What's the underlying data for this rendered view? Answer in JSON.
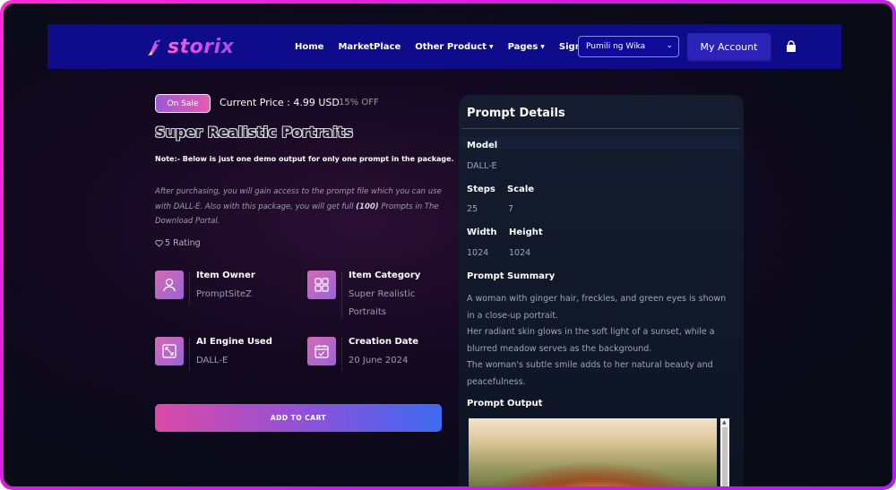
{
  "nav": {
    "logo_text": "storix",
    "links": {
      "home": "Home",
      "marketplace": "MarketPlace",
      "other_product": "Other Product",
      "pages": "Pages",
      "signin": "Sign in"
    },
    "language_select": "Pumili ng Wika",
    "account_button": "My Account"
  },
  "product": {
    "sale_badge": "On Sale",
    "current_price": "Current Price : 4.99 USD",
    "discount": "15% OFF",
    "title": "Super Realistic Portraits",
    "note": "Note:- Below is just one demo output for only one prompt in the package.",
    "desc_part1": "After purchasing, you will gain access to the prompt file which you can use with DALL-E. Also with this package, you will get full ",
    "desc_bold": "(100)",
    "desc_part2": " Prompts in The Download Portal.",
    "rating": "5 Rating",
    "item_owner_label": "Item Owner",
    "item_owner_value": "PromptSiteZ",
    "item_category_label": "Item Category",
    "item_category_value": "Super Realistic Portraits",
    "ai_engine_label": "AI Engine Used",
    "ai_engine_value": "DALL-E",
    "creation_date_label": "Creation Date",
    "creation_date_value": "20 June 2024",
    "add_to_cart": "ADD TO CART"
  },
  "details": {
    "title": "Prompt Details",
    "model_label": "Model",
    "model_value": "DALL-E",
    "steps_label": "Steps",
    "steps_value": "25",
    "scale_label": "Scale",
    "scale_value": "7",
    "width_label": "Width",
    "width_value": "1024",
    "height_label": "Height",
    "height_value": "1024",
    "summary_label": "Prompt Summary",
    "summary_line1": "A woman with ginger hair, freckles, and green eyes is shown in a close-up portrait.",
    "summary_line2": "Her radiant skin glows in the soft light of a sunset, while a blurred meadow serves as the background.",
    "summary_line3": "The woman's subtle smile adds to her natural beauty and peacefulness.",
    "output_label": "Prompt Output"
  },
  "colors": {
    "frame": "#e025e4",
    "navbar": "#0e0c8a",
    "accent_pink": "#dc4aa8",
    "accent_blue": "#3d6af2"
  }
}
